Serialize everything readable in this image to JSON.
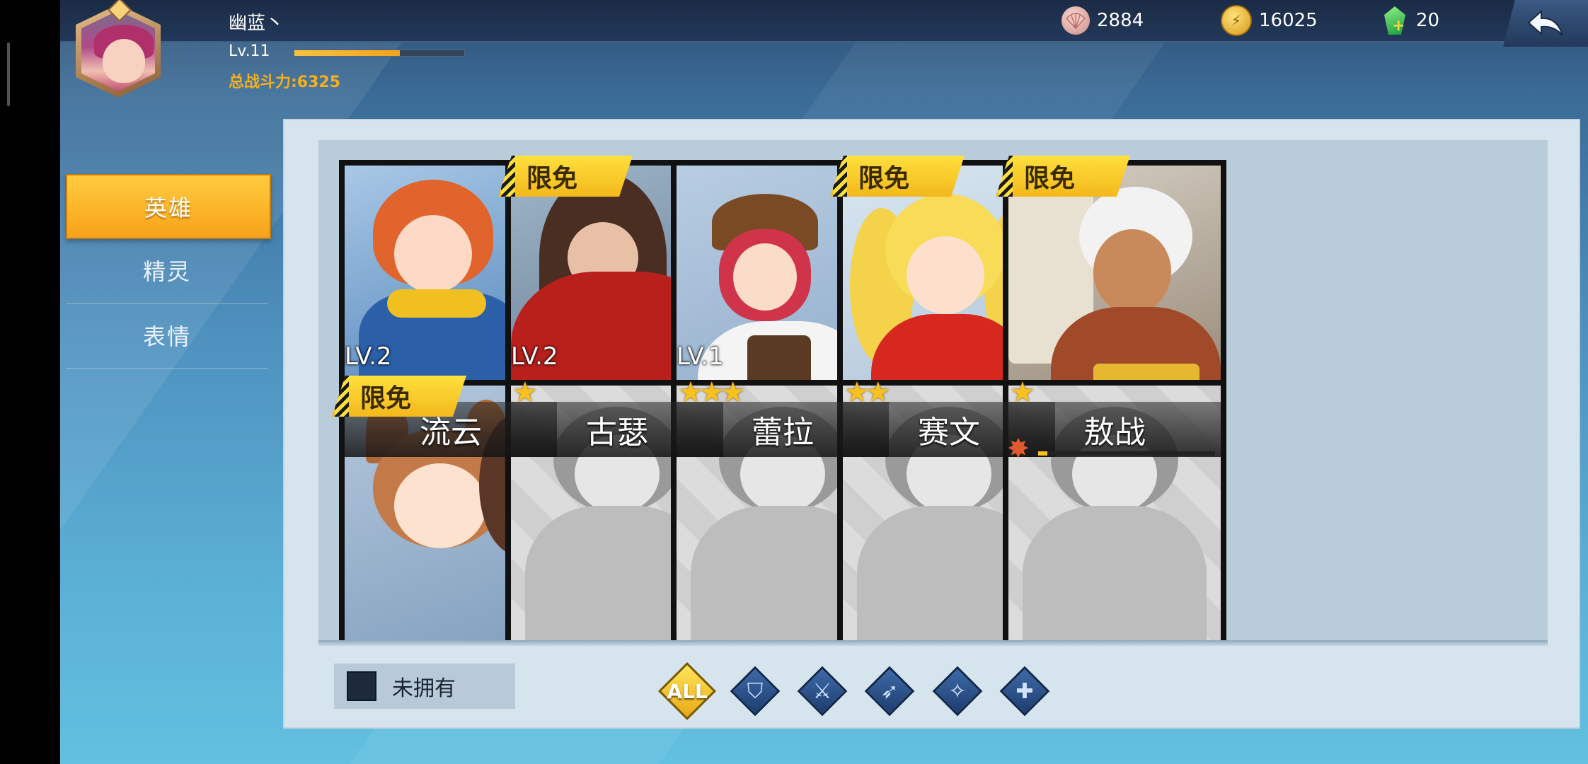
{
  "player": {
    "name": "幽蓝丶",
    "level": "Lv.11",
    "exp_progress": 0.62,
    "total_power": "总战斗力:6325"
  },
  "currencies": [
    {
      "icon": "shell-icon",
      "value": "2884"
    },
    {
      "icon": "gold-coin-icon",
      "value": "16025"
    },
    {
      "icon": "green-gem-icon",
      "value": "20"
    }
  ],
  "tabs": [
    {
      "label": "英雄",
      "active": true
    },
    {
      "label": "精灵",
      "active": false
    },
    {
      "label": "表情",
      "active": false
    }
  ],
  "heroes": [
    {
      "name": "流云",
      "level": "LV.2",
      "stars": 1,
      "badge": "",
      "owned": true,
      "theme": "blue-hero"
    },
    {
      "name": "古瑟",
      "level": "LV.2",
      "stars": 1,
      "badge": "限免",
      "owned": true,
      "theme": "red-cloak"
    },
    {
      "name": "蕾拉",
      "level": "LV.1",
      "stars": 3,
      "badge": "",
      "owned": true,
      "theme": "goggle-girl"
    },
    {
      "name": "赛文",
      "level": "",
      "stars": 2,
      "badge": "限免",
      "owned": true,
      "theme": "blonde-twin"
    },
    {
      "name": "敖战",
      "level": "",
      "stars": 1,
      "badge": "限免",
      "owned": false,
      "fragment_progress": 0.05,
      "theme": "old-warrior"
    },
    {
      "name": "",
      "level": "",
      "stars": 0,
      "badge": "限免",
      "owned": false,
      "theme": "fox-girl"
    },
    {
      "name": "",
      "level": "",
      "stars": 0,
      "badge": "",
      "owned": false,
      "theme": "locked"
    },
    {
      "name": "",
      "level": "",
      "stars": 0,
      "badge": "",
      "owned": false,
      "theme": "locked"
    },
    {
      "name": "",
      "level": "",
      "stars": 0,
      "badge": "",
      "owned": false,
      "theme": "locked"
    },
    {
      "name": "",
      "level": "",
      "stars": 0,
      "badge": "",
      "owned": false,
      "theme": "locked"
    }
  ],
  "filters": {
    "not_owned_label": "未拥有",
    "roles": [
      {
        "icon": "all-filter-icon",
        "label": "ALL",
        "active": true
      },
      {
        "icon": "shield-role-icon",
        "label": "",
        "active": false
      },
      {
        "icon": "sword-role-icon",
        "label": "",
        "active": false
      },
      {
        "icon": "bow-role-icon",
        "label": "",
        "active": false
      },
      {
        "icon": "magic-role-icon",
        "label": "",
        "active": false
      },
      {
        "icon": "heal-role-icon",
        "label": "",
        "active": false
      }
    ]
  },
  "colors": {
    "accent": "#f7a21a",
    "star": "#f7c21e",
    "power_text": "#f4b01e",
    "badge": "#ffe03c"
  }
}
